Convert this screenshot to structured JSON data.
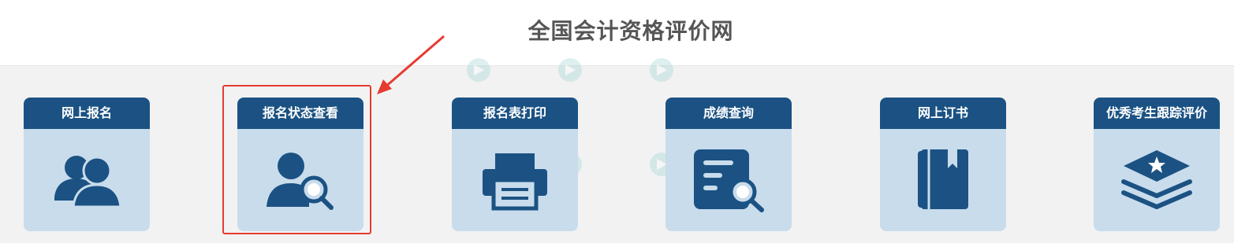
{
  "page": {
    "title": "全国会计资格评价网"
  },
  "cards": [
    {
      "label": "网上报名",
      "icon": "users-icon"
    },
    {
      "label": "报名状态查看",
      "icon": "user-search-icon"
    },
    {
      "label": "报名表打印",
      "icon": "printer-icon"
    },
    {
      "label": "成绩查询",
      "icon": "document-search-icon"
    },
    {
      "label": "网上订书",
      "icon": "book-icon"
    },
    {
      "label": "优秀考生跟踪评价",
      "icon": "layers-star-icon"
    }
  ],
  "annotation": {
    "highlighted_card": "报名状态查看",
    "color": "#e53b30"
  },
  "colors": {
    "card_header": "#1b5283",
    "card_body": "#c9dcec",
    "icon": "#1b5283",
    "background": "#f2f2f2"
  }
}
